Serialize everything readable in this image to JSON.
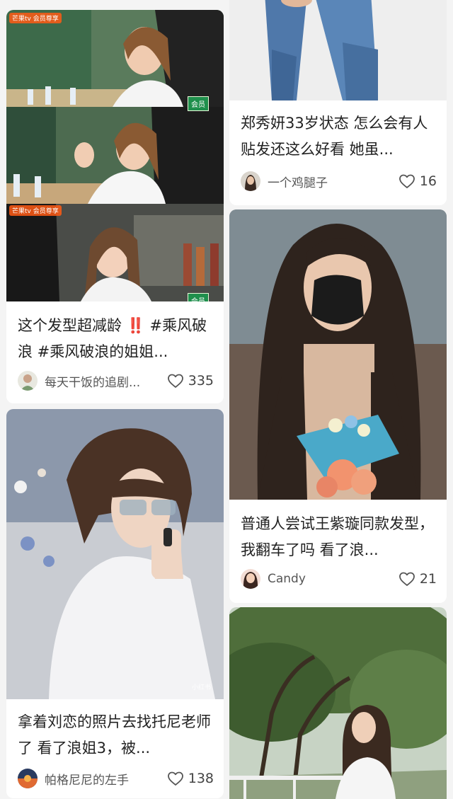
{
  "feed": {
    "cards": [
      {
        "title": "这个发型超减龄 ‼️ #乘风破浪 #乘风破浪的姐姐...",
        "author": "每天干饭的追剧...",
        "likes": "335",
        "logo_text": "芒果tv 会员尊享",
        "show_text": "会员"
      },
      {
        "title": "郑秀妍33岁状态 怎么会有人贴发还这么好看 她虽...",
        "author": "一个鸡腿子",
        "likes": "16"
      },
      {
        "title": "普通人尝试王紫璇同款发型，我翻车了吗 看了浪...",
        "author": "Candy",
        "likes": "21"
      },
      {
        "title": "拿着刘恋的照片去找托尼老师了 看了浪姐3，被...",
        "author": "帕格尼尼的左手",
        "likes": "138",
        "watermark": "小红书"
      },
      {
        "image_only": true
      }
    ]
  },
  "colors": {
    "background": "#f4f4f4",
    "card": "#ffffff",
    "title_text": "#222222",
    "meta_text": "#555555"
  },
  "icons": {
    "like": "heart-outline-icon"
  }
}
